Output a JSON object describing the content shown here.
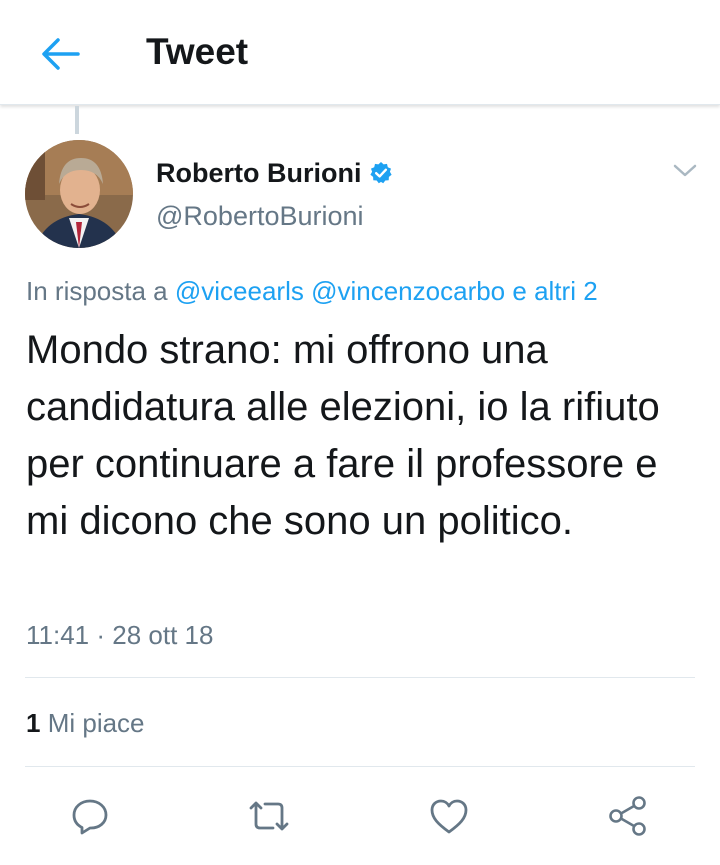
{
  "header": {
    "title": "Tweet",
    "back_icon": "arrow-left-icon"
  },
  "author": {
    "name": "Roberto Burioni",
    "handle": "@RobertoBurioni",
    "verified": true
  },
  "reply": {
    "prefix": "In risposta a",
    "mentions": [
      "@viceearls",
      "@vincenzocarbo"
    ],
    "others": "e altri 2"
  },
  "tweet": {
    "text": "Mondo strano: mi offrono una candidatura alle elezioni, io la rifiuto per continuare a fare il professore e mi dicono che sono un politico.",
    "timestamp": "11:41 · 28 ott 18"
  },
  "stats": {
    "likes_count": "1",
    "likes_label": "Mi piace"
  },
  "actions": [
    "reply-icon",
    "retweet-icon",
    "like-icon",
    "share-icon"
  ],
  "colors": {
    "accent": "#1da1f2",
    "secondary_text": "#657786",
    "divider": "#e1e8ed"
  }
}
